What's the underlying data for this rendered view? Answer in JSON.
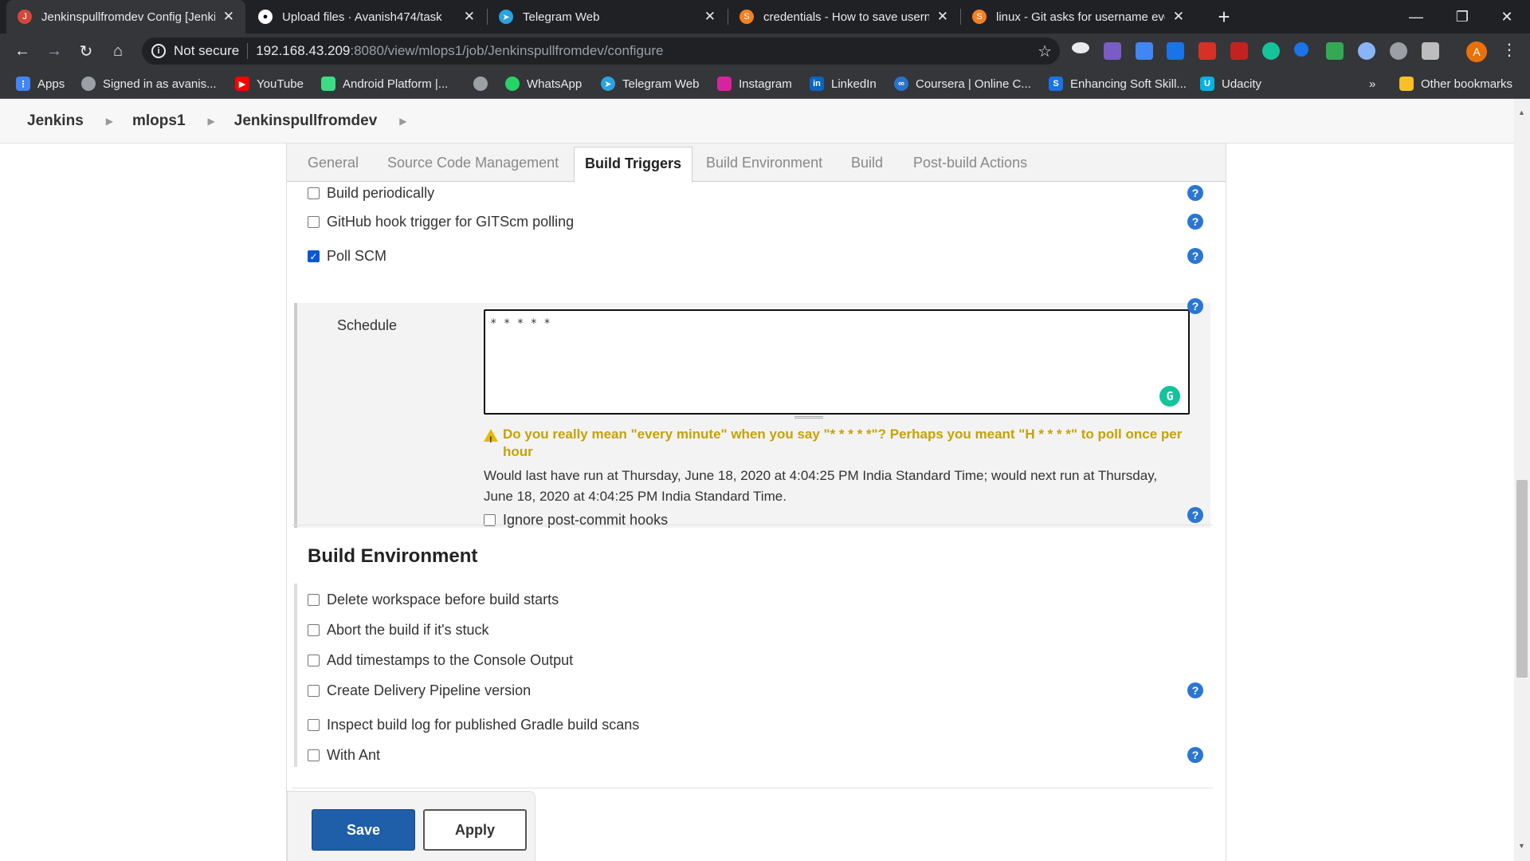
{
  "browser": {
    "tabs": [
      {
        "title": "Jenkinspullfromdev Config [Jenkins]",
        "active": true
      },
      {
        "title": "Upload files · Avanish474/task",
        "active": false
      },
      {
        "title": "Telegram Web",
        "active": false
      },
      {
        "title": "credentials - How to save username",
        "active": false
      },
      {
        "title": "linux - Git asks for username every time",
        "active": false
      }
    ],
    "address": {
      "security_label": "Not secure",
      "host": "192.168.43.209",
      "path": ":8080/view/mlops1/job/Jenkinspullfromdev/configure"
    },
    "profile_initial": "A",
    "bookmarks": [
      {
        "label": "Apps",
        "color": "#4285f4"
      },
      {
        "label": "Signed in as avanis...",
        "color": "#9aa0a6"
      },
      {
        "label": "YouTube",
        "color": "#ff0000"
      },
      {
        "label": "Android Platform |...",
        "color": "#3ddc84"
      },
      {
        "label": "",
        "color": "#9aa0a6"
      },
      {
        "label": "WhatsApp",
        "color": "#25d366"
      },
      {
        "label": "Telegram Web",
        "color": "#2aa3e0"
      },
      {
        "label": "Instagram",
        "color": "#d6249f"
      },
      {
        "label": "LinkedIn",
        "color": "#0a66c2"
      },
      {
        "label": "Coursera | Online C...",
        "color": "#2a73cc"
      },
      {
        "label": "Enhancing Soft Skill...",
        "color": "#1a73e8"
      },
      {
        "label": "Udacity",
        "color": "#02b3e4"
      }
    ],
    "bookmarks_overflow": "»",
    "other_bookmarks": "Other bookmarks"
  },
  "breadcrumb": [
    "Jenkins",
    "mlops1",
    "Jenkinspullfromdev"
  ],
  "config_tabs": [
    "General",
    "Source Code Management",
    "Build Triggers",
    "Build Environment",
    "Build",
    "Post-build Actions"
  ],
  "build_triggers": {
    "build_periodically": "Build periodically",
    "github_hook": "GitHub hook trigger for GITScm polling",
    "poll_scm": "Poll SCM",
    "schedule_label": "Schedule",
    "schedule_value": "* * * * *",
    "warning": "Do you really mean \"every minute\" when you say \"* * * * *\"? Perhaps you meant \"H * * * *\" to poll once per hour",
    "run_info": "Would last have run at Thursday, June 18, 2020 at 4:04:25 PM India Standard Time; would next run at Thursday, June 18, 2020 at 4:04:25 PM India Standard Time.",
    "ignore_hooks": "Ignore post-commit hooks"
  },
  "build_environment": {
    "title": "Build Environment",
    "options": [
      "Delete workspace before build starts",
      "Abort the build if it's stuck",
      "Add timestamps to the Console Output",
      "Create Delivery Pipeline version",
      "Inspect build log for published Gradle build scans",
      "With Ant"
    ]
  },
  "buttons": {
    "save": "Save",
    "apply": "Apply"
  },
  "colors": {
    "accent": "#1f5ea8",
    "warning": "#c6a203",
    "help": "#2b76d2"
  }
}
